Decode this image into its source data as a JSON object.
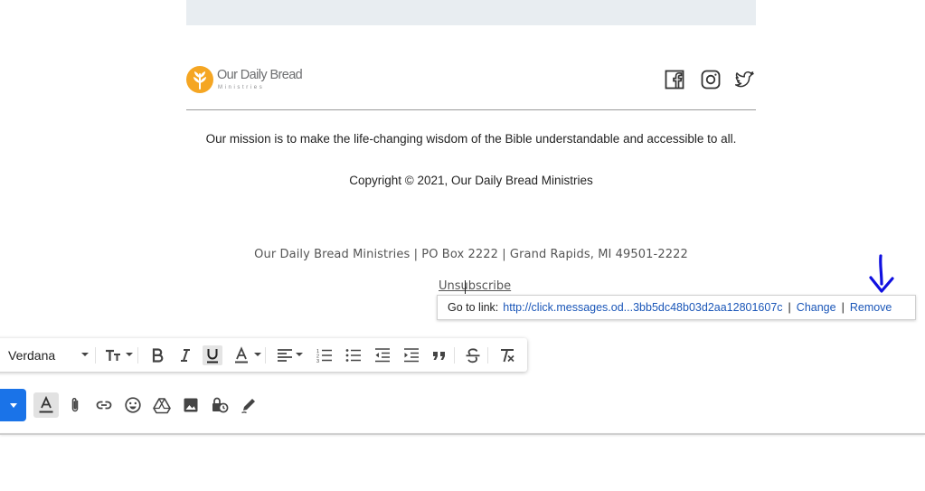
{
  "email": {
    "brand": {
      "name": "Our Daily Bread",
      "subname": "Ministries",
      "accent_color": "#f5a623",
      "icon": "wheat-logo-icon"
    },
    "social": [
      {
        "name": "facebook",
        "icon": "facebook-icon"
      },
      {
        "name": "instagram",
        "icon": "instagram-icon"
      },
      {
        "name": "twitter",
        "icon": "twitter-icon"
      }
    ],
    "mission": "Our mission is to make the life-changing wisdom of the Bible understandable and accessible to all.",
    "copyright": "Copyright © 2021, Our Daily Bread Ministries",
    "address": "Our Daily Bread Ministries | PO Box 2222 | Grand Rapids, MI 49501-2222",
    "unsubscribe_label": "Unsubscribe"
  },
  "link_popup": {
    "goto_label": "Go to link:",
    "url": "http://click.messages.od...3bb5dc48b03d2aa12801607c",
    "separator": "|",
    "change_label": "Change",
    "remove_label": "Remove",
    "link_color": "#1a56b8"
  },
  "annotation": {
    "icon": "down-arrow-annotation",
    "color": "#1010e0"
  },
  "formatting_toolbar": {
    "font": "Verdana",
    "items": [
      "font-size-icon",
      "bold-icon",
      "italic-icon",
      "underline-icon",
      "text-color-icon",
      "align-icon",
      "numbered-list-icon",
      "bulleted-list-icon",
      "indent-less-icon",
      "indent-more-icon",
      "quote-icon",
      "strikethrough-icon",
      "remove-formatting-icon"
    ],
    "active": [
      "underline-icon"
    ]
  },
  "compose_bar": {
    "send_color": "#1a73e8",
    "items": [
      "formatting-options-icon",
      "attach-icon",
      "link-icon",
      "emoji-icon",
      "drive-icon",
      "photo-icon",
      "confidential-icon",
      "signature-icon"
    ]
  }
}
